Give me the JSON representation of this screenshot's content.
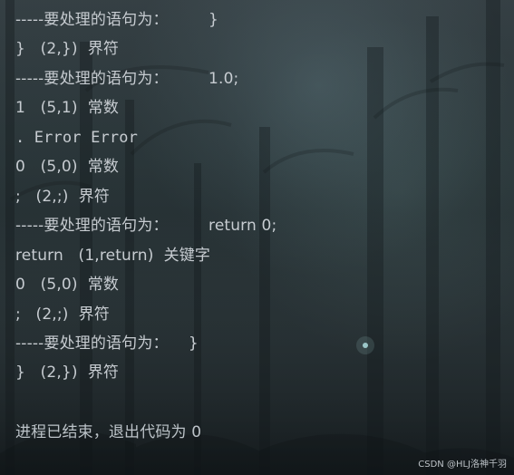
{
  "console": {
    "lines": [
      "-----要处理的语句为：        }",
      "}   (2,})  界符",
      "-----要处理的语句为：        1.0;",
      "1   (5,1)  常数",
      ". Error Error",
      "0   (5,0)  常数",
      ";   (2,;)  界符",
      "-----要处理的语句为：        return 0;",
      "return   (1,return)  关键字",
      "0   (5,0)  常数",
      ";   (2,;)  界符",
      "-----要处理的语句为：    }",
      "}   (2,})  界符",
      "",
      "进程已结束，退出代码为 0"
    ]
  },
  "watermark": {
    "text": "CSDN @HLJ洛神千羽"
  }
}
